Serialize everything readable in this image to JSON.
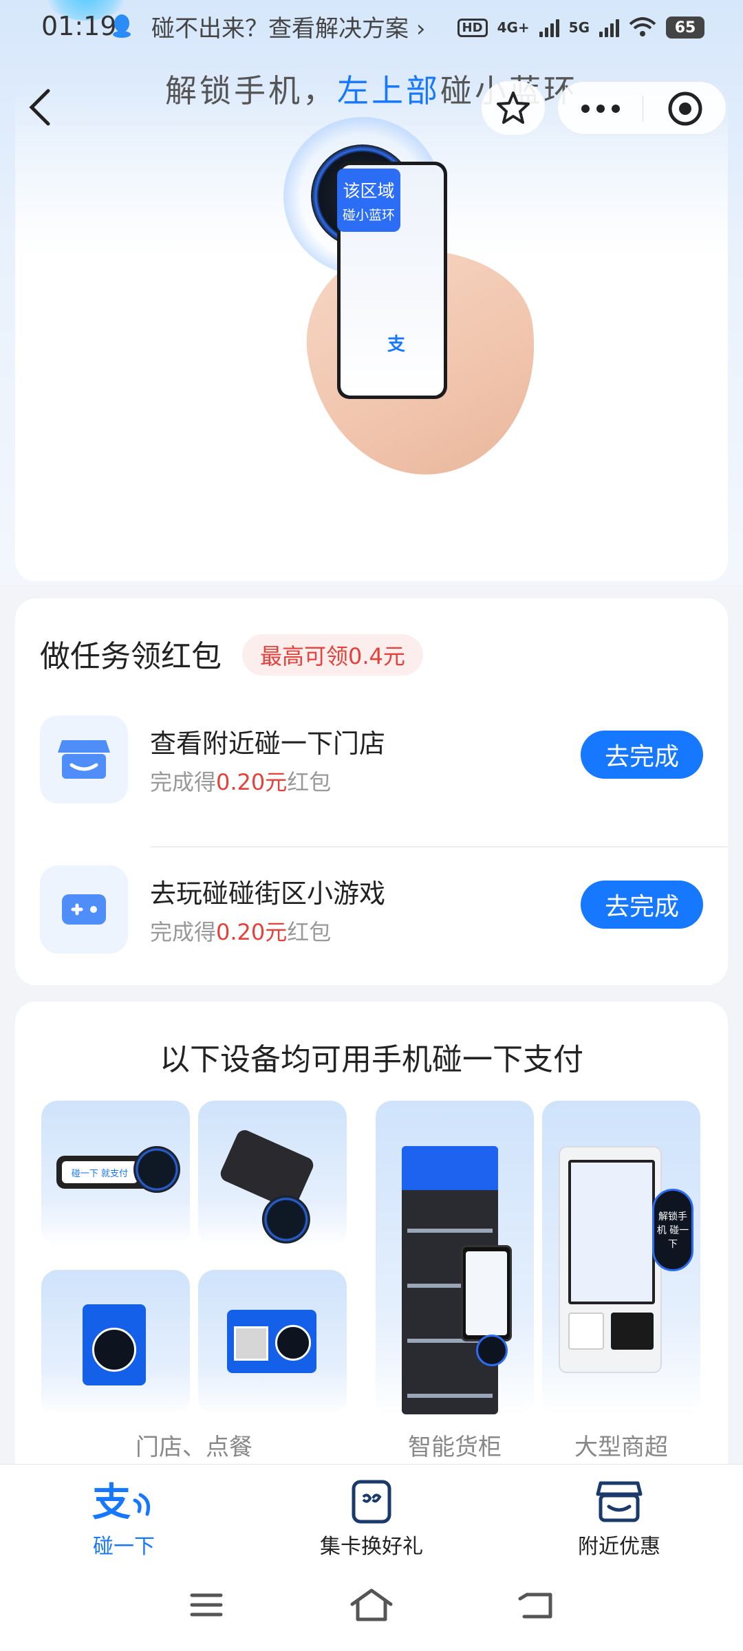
{
  "status_bar": {
    "time": "01:19",
    "tip": "碰不出来？查看解决方案",
    "hd": "HD",
    "net1": "4G+",
    "net2": "5G",
    "battery": "65"
  },
  "header": {
    "title_prefix": "解锁手机，",
    "title_highlight": "左上部",
    "title_suffix": "碰小蓝环"
  },
  "illustration": {
    "tag_line1": "该区域",
    "tag_line2": "碰小蓝环",
    "logo": "支"
  },
  "tasks": {
    "title": "做任务领红包",
    "badge": "最高可领0.4元",
    "items": [
      {
        "name": "查看附近碰一下门店",
        "reward_prefix": "完成得",
        "reward_amount": "0.20元",
        "reward_suffix": "红包",
        "button": "去完成",
        "icon": "store-icon"
      },
      {
        "name": "去玩碰碰街区小游戏",
        "reward_prefix": "完成得",
        "reward_amount": "0.20元",
        "reward_suffix": "红包",
        "button": "去完成",
        "icon": "gamepad-icon"
      }
    ]
  },
  "devices": {
    "title": "以下设备均可用手机碰一下支付",
    "captions": [
      "门店、点餐",
      "智能货柜",
      "大型商超"
    ],
    "device_texts": {
      "terminal": "碰一下 就支付",
      "kiosk_side": "解锁手机 碰一下"
    }
  },
  "bottom_nav": {
    "items": [
      {
        "label": "碰一下",
        "icon": "alipay-tap-icon",
        "active": true
      },
      {
        "label": "集卡换好礼",
        "icon": "card-icon",
        "active": false
      },
      {
        "label": "附近优惠",
        "icon": "shop-icon",
        "active": false
      }
    ]
  },
  "colors": {
    "accent": "#1677ff",
    "reward": "#e5413a"
  }
}
